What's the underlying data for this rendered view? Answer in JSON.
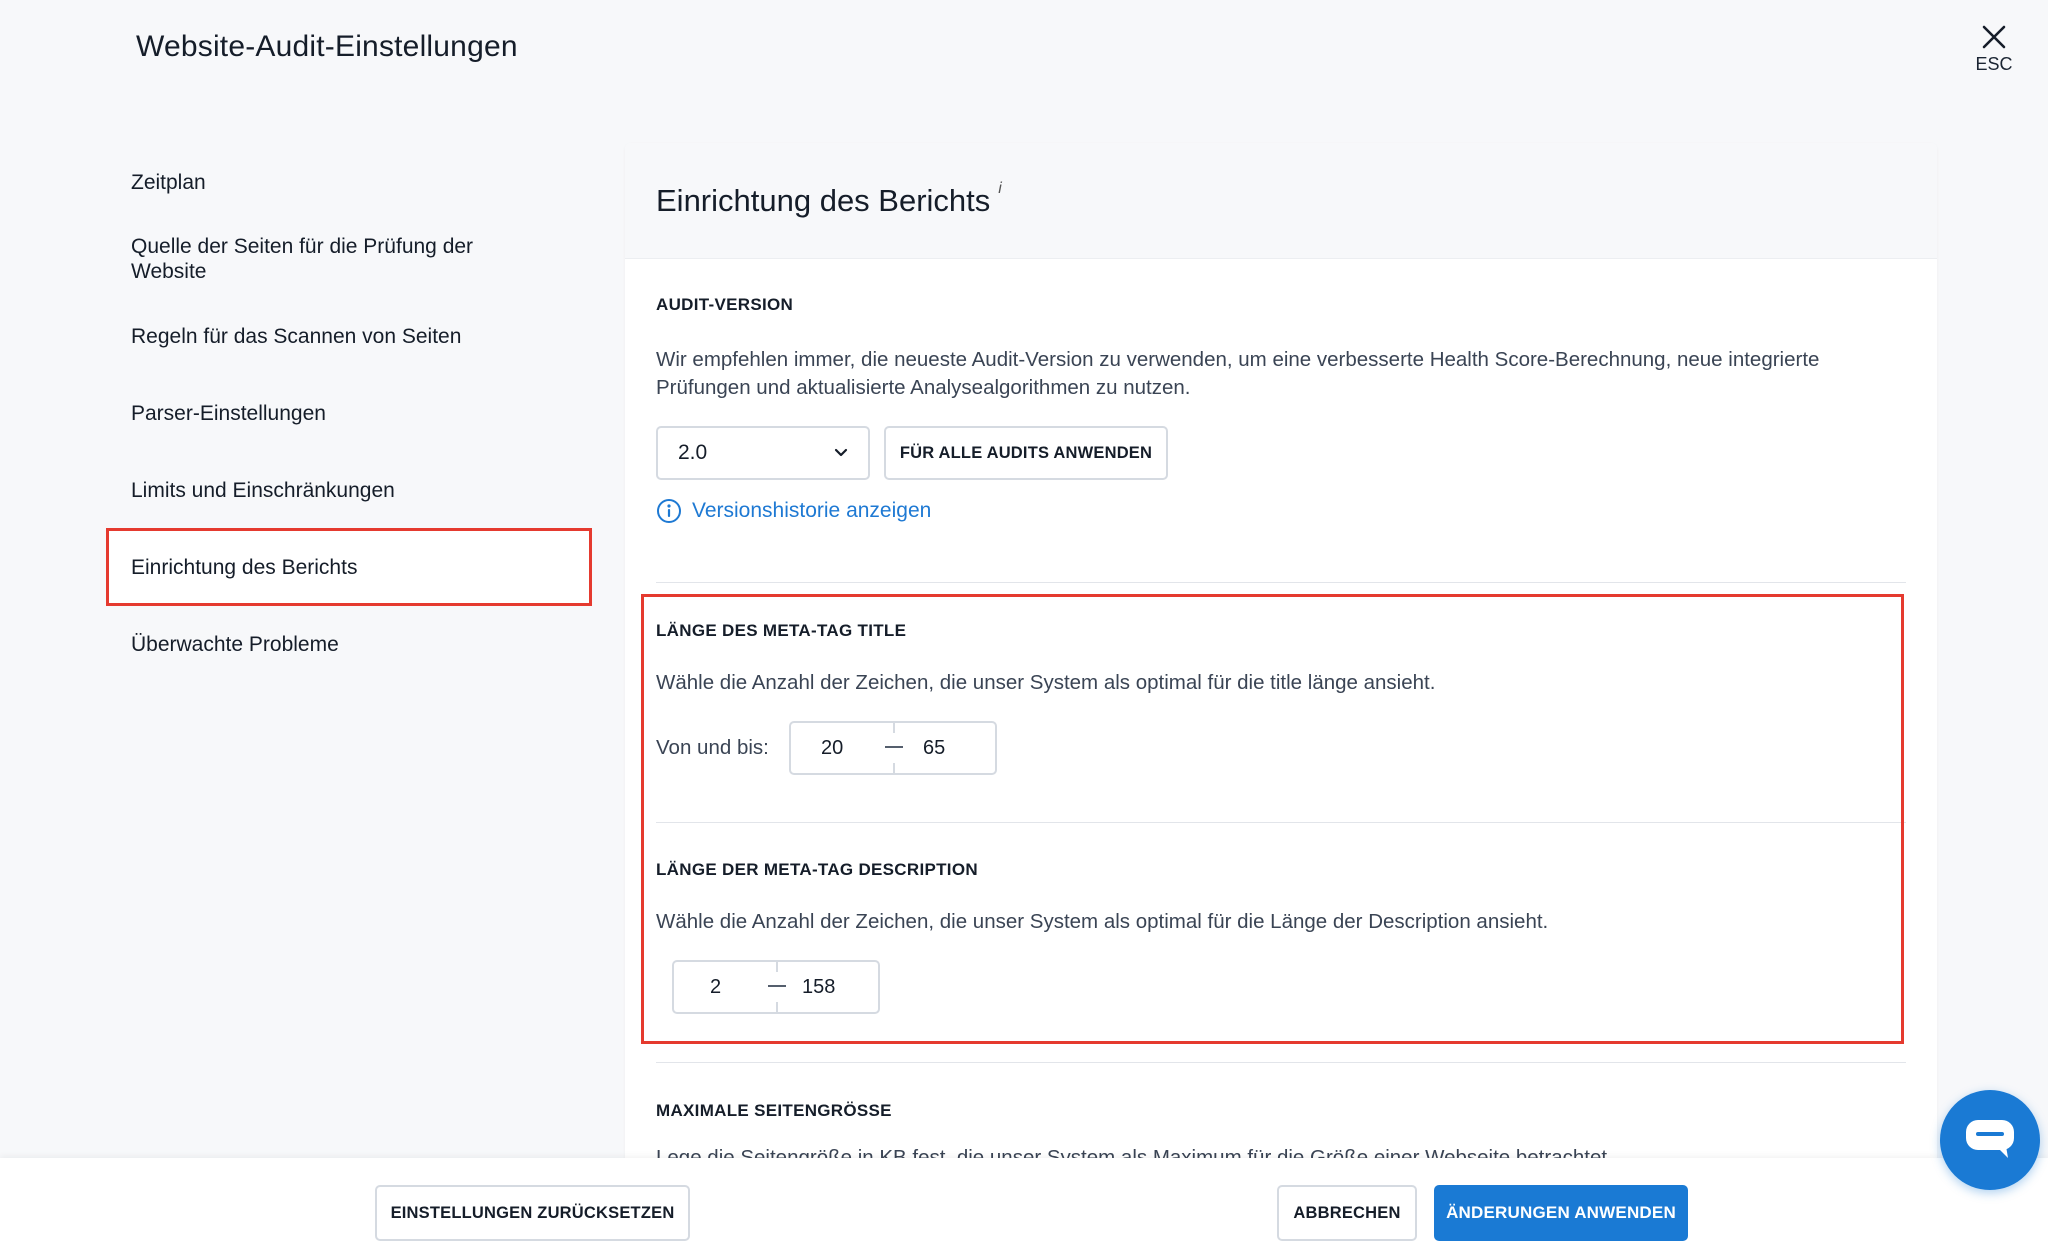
{
  "header": {
    "title": "Website-Audit-Einstellungen",
    "esc_label": "ESC"
  },
  "sidebar": {
    "items": [
      {
        "label": "Zeitplan"
      },
      {
        "label": "Quelle der Seiten für die Prüfung der Website"
      },
      {
        "label": "Regeln für das Scannen von Seiten"
      },
      {
        "label": "Parser-Einstellungen"
      },
      {
        "label": "Limits und Einschränkungen"
      },
      {
        "label": "Einrichtung des Berichts",
        "active": true
      },
      {
        "label": "Überwachte Probleme"
      }
    ]
  },
  "panel": {
    "title": "Einrichtung des Berichts",
    "info_marker": "i",
    "audit_version": {
      "label": "AUDIT-VERSION",
      "description": "Wir empfehlen immer, die neueste Audit-Version zu verwenden, um eine verbesserte Health Score-Berechnung, neue integrierte Prüfungen und aktualisierte Analysealgorithmen zu nutzen.",
      "selected_version": "2.0",
      "apply_all_label": "FÜR ALLE AUDITS ANWENDEN",
      "history_link": "Versionshistorie anzeigen"
    },
    "meta_title": {
      "label": "LÄNGE DES META-TAG TITLE",
      "description": "Wähle die Anzahl der Zeichen, die unser System als optimal für die title länge ansieht.",
      "range_label": "Von und bis:",
      "from": "20",
      "to": "65"
    },
    "meta_description": {
      "label": "LÄNGE DER META-TAG DESCRIPTION",
      "description": "Wähle die Anzahl der Zeichen, die unser System als optimal für die Länge der Description ansieht.",
      "from": "2",
      "to": "158"
    },
    "max_page_size": {
      "label": "MAXIMALE SEITENGRÖSSE",
      "description_partial": "Lege die Seitengröße in KB fest, die unser System als Maximum für die Größe einer Webseite betrachtet."
    }
  },
  "footer": {
    "reset_label": "EINSTELLUNGEN ZURÜCKSETZEN",
    "cancel_label": "ABBRECHEN",
    "apply_label": "ÄNDERUNGEN ANWENDEN"
  },
  "colors": {
    "accent": "#1a7ad4",
    "highlight": "#e53a2f",
    "background": "#f7f8fa"
  },
  "icons": {
    "close": "close-icon",
    "chevron": "chevron-down-icon",
    "info": "info-circle-icon",
    "chat": "chat-bubble-icon"
  }
}
